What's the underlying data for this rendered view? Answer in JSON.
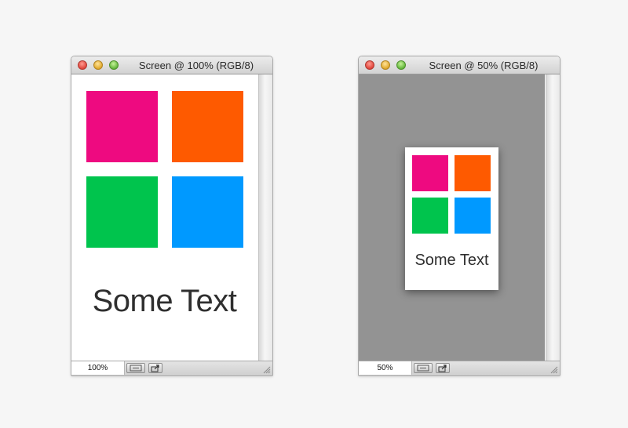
{
  "windows": [
    {
      "title": "Screen @ 100% (RGB/8)",
      "zoom": "100%",
      "canvas_text": "Some Text",
      "canvas_background": "#ffffff"
    },
    {
      "title": "Screen @ 50% (RGB/8)",
      "zoom": "50%",
      "canvas_text": "Some Text",
      "canvas_background": "#939393"
    }
  ],
  "swatch_colors": {
    "pink": "#ee0a80",
    "orange": "#fe5a00",
    "green": "#00c44d",
    "blue": "#0099ff"
  },
  "icons": {
    "info_button": "document-info-icon",
    "share_button": "share-arrow-icon",
    "grip": "resize-grip-icon"
  }
}
